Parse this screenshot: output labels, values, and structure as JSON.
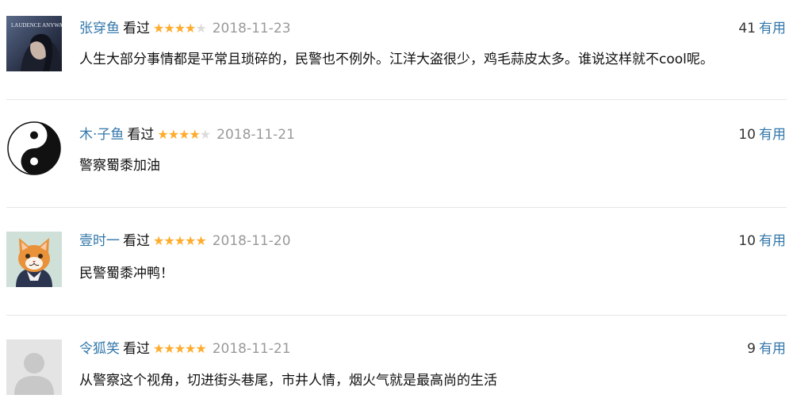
{
  "comments": [
    {
      "user": "张穿鱼",
      "status": "看过",
      "rating": 4,
      "stars_on": "★★★★",
      "stars_off": "★",
      "date": "2018-11-23",
      "useful_count": "41",
      "useful_label": "有用",
      "text": "人生大部分事情都是平常且琐碎的，民警也不例外。江洋大盗很少，鸡毛蒜皮太多。谁说这样就不cool呢。",
      "avatar": {
        "icon": "movie-poster-avatar",
        "poster_text": "LAUDENCE ANYWAYS"
      }
    },
    {
      "user": "木·子鱼",
      "status": "看过",
      "rating": 4,
      "stars_on": "★★★★",
      "stars_off": "★",
      "date": "2018-11-21",
      "useful_count": "10",
      "useful_label": "有用",
      "text": "警察蜀黍加油",
      "avatar": {
        "icon": "yin-yang-avatar"
      }
    },
    {
      "user": "壹时一",
      "status": "看过",
      "rating": 5,
      "stars_on": "★★★★★",
      "stars_off": "",
      "date": "2018-11-20",
      "useful_count": "10",
      "useful_label": "有用",
      "text": "民警蜀黍冲鸭！",
      "avatar": {
        "icon": "cat-avatar"
      }
    },
    {
      "user": "令狐笑",
      "status": "看过",
      "rating": 5,
      "stars_on": "★★★★★",
      "stars_off": "",
      "date": "2018-11-21",
      "useful_count": "9",
      "useful_label": "有用",
      "text": "从警察这个视角，切进街头巷尾，市井人情，烟火气就是最高尚的生活",
      "avatar": {
        "icon": "default-user-avatar"
      }
    }
  ],
  "colors": {
    "link": "#3377aa",
    "star": "#ffac2d",
    "star_empty": "#dcdcdc",
    "date": "#999999",
    "divider": "#e6e6e6"
  }
}
